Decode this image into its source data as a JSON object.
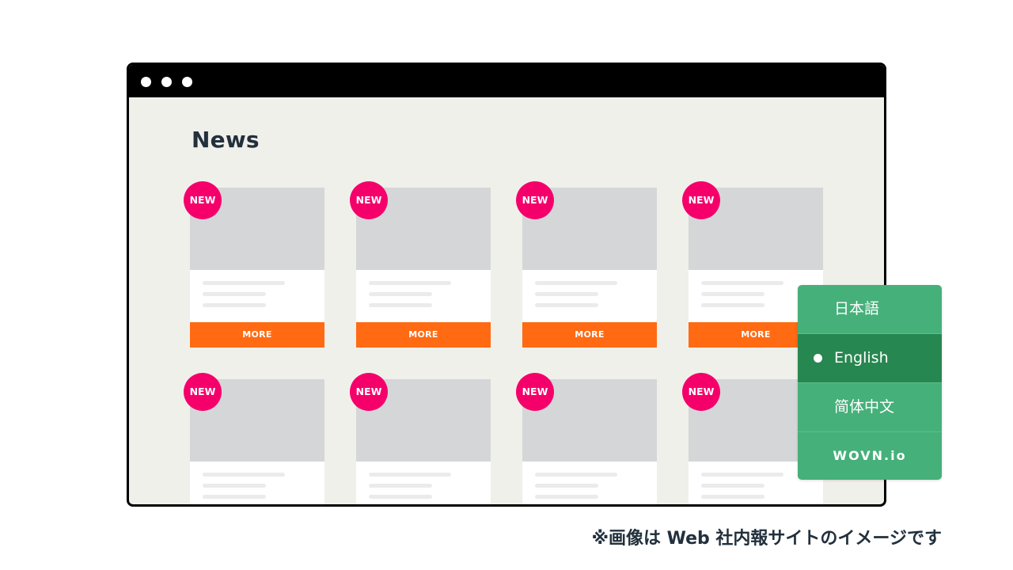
{
  "page": {
    "title": "News",
    "caption": "※画像は Web 社内報サイトのイメージです"
  },
  "cards": [
    {
      "badge": "NEW",
      "more_label": "MORE"
    },
    {
      "badge": "NEW",
      "more_label": "MORE"
    },
    {
      "badge": "NEW",
      "more_label": "MORE"
    },
    {
      "badge": "NEW",
      "more_label": "MORE"
    },
    {
      "badge": "NEW"
    },
    {
      "badge": "NEW"
    },
    {
      "badge": "NEW"
    },
    {
      "badge": "NEW"
    }
  ],
  "language_switcher": {
    "languages": [
      {
        "label": "日本語",
        "selected": false
      },
      {
        "label": "English",
        "selected": true
      },
      {
        "label": "简体中文",
        "selected": false
      }
    ],
    "brand": "WOVN.io"
  },
  "colors": {
    "badge": "#f5006b",
    "more_button": "#ff6a13",
    "switcher": "#45b07a",
    "switcher_selected": "#278750",
    "page_background": "#f0f0ea"
  },
  "icons": [
    "window-control-dot",
    "selected-language-dot"
  ]
}
